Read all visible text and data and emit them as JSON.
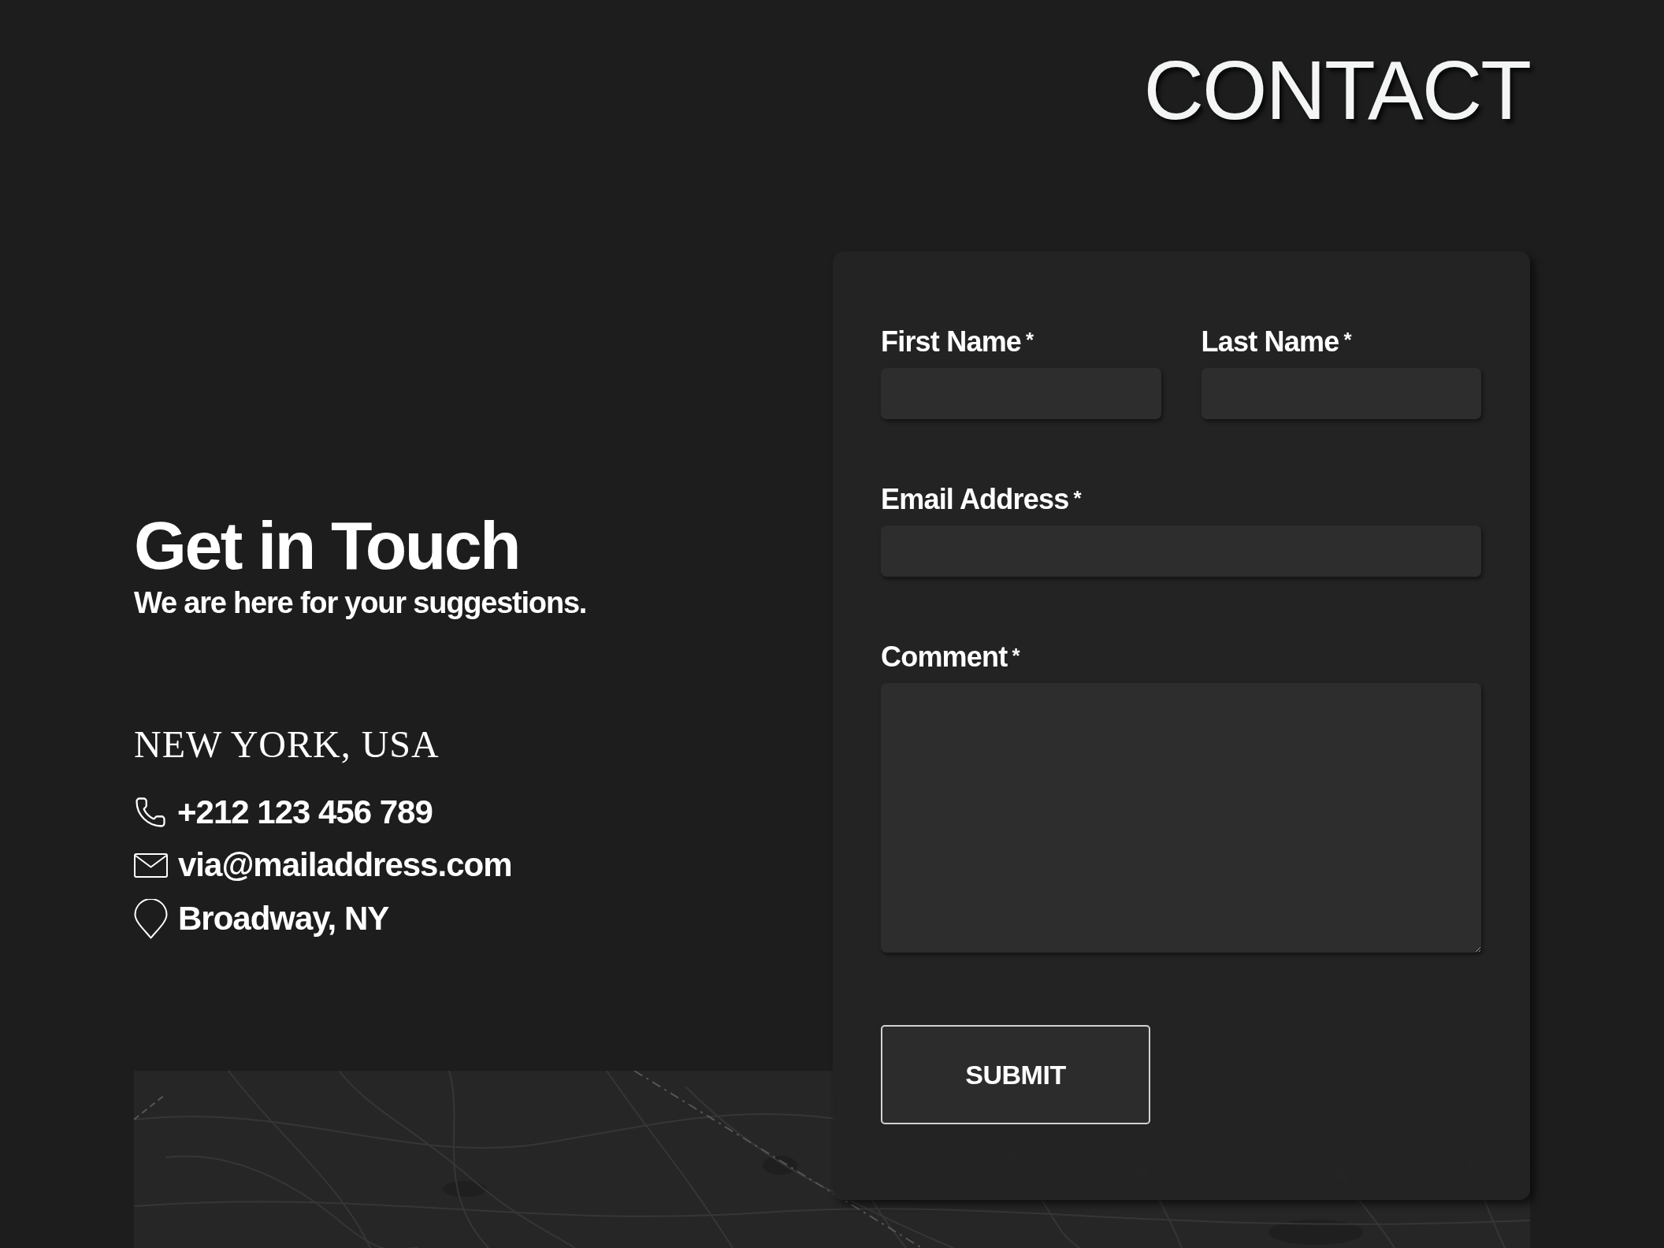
{
  "page": {
    "title": "CONTACT"
  },
  "intro": {
    "heading": "Get in Touch",
    "subheading": "We are here for your suggestions."
  },
  "location": {
    "title": "NEW YORK, USA",
    "items": [
      {
        "kind": "phone",
        "text": "+212 123 456 789"
      },
      {
        "kind": "email",
        "text": "via@mailaddress.com"
      },
      {
        "kind": "address",
        "text": "Broadway, NY"
      }
    ]
  },
  "form": {
    "rows": [
      [
        {
          "kind": "text",
          "label": "First Name",
          "mark": "*"
        },
        {
          "kind": "text",
          "label": "Last Name",
          "mark": "*"
        }
      ],
      [
        {
          "kind": "email",
          "label": "Email Address",
          "mark": "*"
        }
      ],
      [
        {
          "kind": "textarea",
          "label": "Comment",
          "mark": "*"
        }
      ]
    ],
    "submit": "SUBMIT"
  }
}
